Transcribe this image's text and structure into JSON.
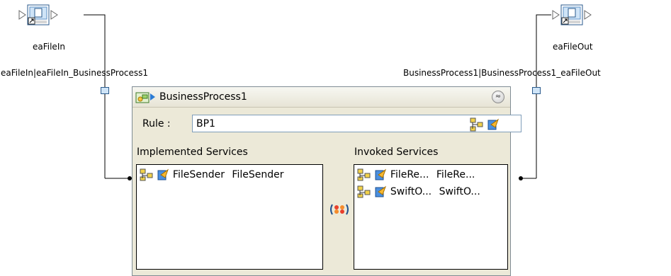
{
  "nodes": {
    "left": {
      "label": "eaFileIn"
    },
    "right": {
      "label": "eaFileOut"
    }
  },
  "links": {
    "left_label": "eaFileIn|eaFileIn_BusinessProcess1",
    "right_label": "BusinessProcess1|BusinessProcess1_eaFileOut"
  },
  "business_process": {
    "title": "BusinessProcess1",
    "collapse_glyph": "≈",
    "rule_label": "Rule :",
    "rule_value": "BP1",
    "implemented_label": "Implemented Services",
    "invoked_label": "Invoked Services",
    "implemented": [
      {
        "name": "FileSender",
        "type": "FileSender"
      }
    ],
    "invoked": [
      {
        "name": "FileRe...",
        "type": "FileRe..."
      },
      {
        "name": "SwiftO...",
        "type": "SwiftO..."
      }
    ]
  },
  "icons": [
    "app-node-icon",
    "business-process-icon",
    "collapse-icon",
    "tree-icon",
    "service-icon",
    "link-icon"
  ]
}
